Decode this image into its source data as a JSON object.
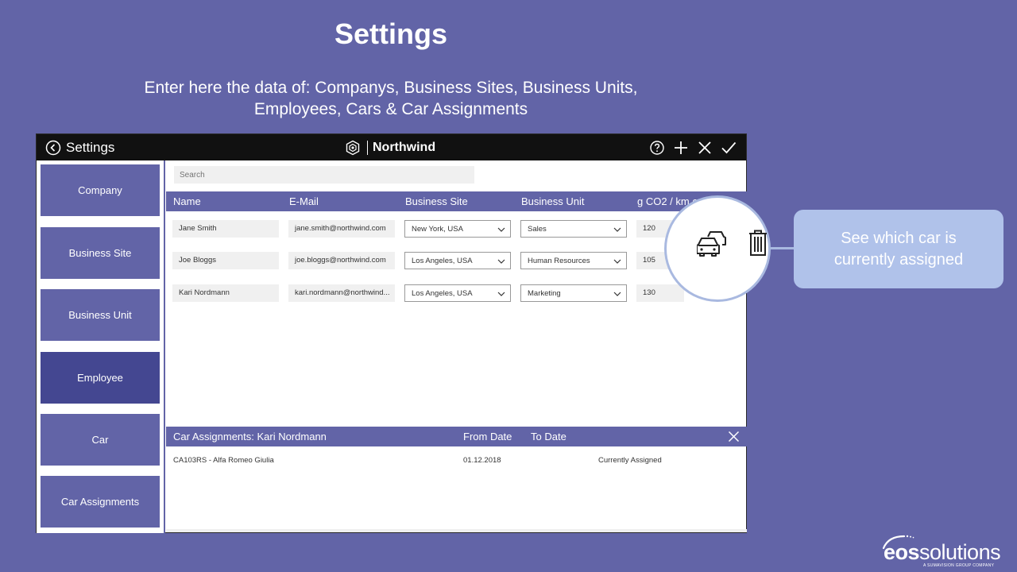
{
  "slide": {
    "title": "Settings",
    "subtitle_line1": "Enter here the data of: Companys, Business Sites, Business Units,",
    "subtitle_line2": "Employees, Cars & Car Assignments"
  },
  "topbar": {
    "back_label": "Settings",
    "brand": "Northwind",
    "icons": [
      "help-icon",
      "plus-icon",
      "close-icon",
      "check-icon"
    ]
  },
  "sidebar": {
    "items": [
      {
        "label": "Company"
      },
      {
        "label": "Business Site"
      },
      {
        "label": "Business Unit"
      },
      {
        "label": "Employee",
        "active": true
      },
      {
        "label": "Car"
      },
      {
        "label": "Car Assignments"
      }
    ]
  },
  "search": {
    "placeholder": "Search"
  },
  "grid": {
    "columns": [
      "Name",
      "E-Mail",
      "Business Site",
      "Business Unit",
      "g CO2 / km c..."
    ],
    "rows": [
      {
        "name": "Jane Smith",
        "email": "jane.smith@northwind.com",
        "site": "New York, USA",
        "unit": "Sales",
        "co2": "120"
      },
      {
        "name": "Joe Bloggs",
        "email": "joe.bloggs@northwind.com",
        "site": "Los Angeles, USA",
        "unit": "Human Resources",
        "co2": "105"
      },
      {
        "name": "Kari Nordmann",
        "email": "kari.nordmann@northwind...",
        "site": "Los Angeles, USA",
        "unit": "Marketing",
        "co2": "130"
      }
    ]
  },
  "assignments": {
    "title": "Car Assignments: Kari Nordmann",
    "from_label": "From Date",
    "to_label": "To Date",
    "rows": [
      {
        "car": "CA103RS - Alfa Romeo Giulia",
        "from": "01.12.2018",
        "to": "Currently Assigned"
      }
    ]
  },
  "callout": {
    "line1": "See which car is",
    "line2": "currently assigned"
  },
  "logo": {
    "text_light": "eos",
    "text_rest": "solutions",
    "tagline": "A SUMAVISION GROUP COMPANY"
  },
  "colors": {
    "background": "#6264a7",
    "active_nav": "#444791",
    "callout": "#b0c2ea"
  }
}
